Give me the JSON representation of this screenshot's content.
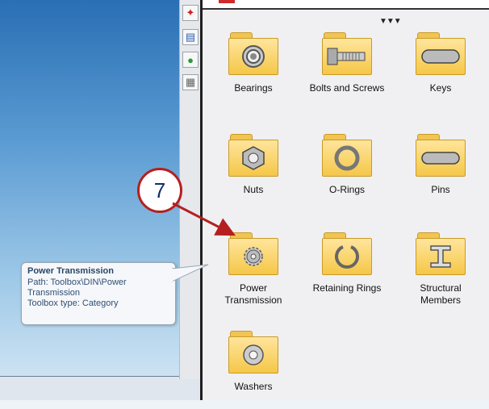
{
  "toolbox": {
    "items": [
      {
        "label": "Bearings",
        "icon": "bearing-icon"
      },
      {
        "label": "Bolts and Screws",
        "icon": "bolt-icon"
      },
      {
        "label": "Keys",
        "icon": "key-icon"
      },
      {
        "label": "Nuts",
        "icon": "nut-icon"
      },
      {
        "label": "O-Rings",
        "icon": "o-ring-icon"
      },
      {
        "label": "Pins",
        "icon": "pin-icon"
      },
      {
        "label": "Power\nTransmission",
        "icon": "gear-icon"
      },
      {
        "label": "Retaining Rings",
        "icon": "retaining-ring-icon"
      },
      {
        "label": "Structural\nMembers",
        "icon": "i-beam-icon"
      },
      {
        "label": "Washers",
        "icon": "washer-icon"
      }
    ]
  },
  "tooltip": {
    "title": "Power Transmission",
    "path": "Path: Toolbox\\DIN\\Power\nTransmission",
    "type": "Toolbox type: Category"
  },
  "callout": {
    "number": "7"
  },
  "colors": {
    "callout_red": "#b51f1f",
    "folder_yellow": "#f5c748"
  }
}
